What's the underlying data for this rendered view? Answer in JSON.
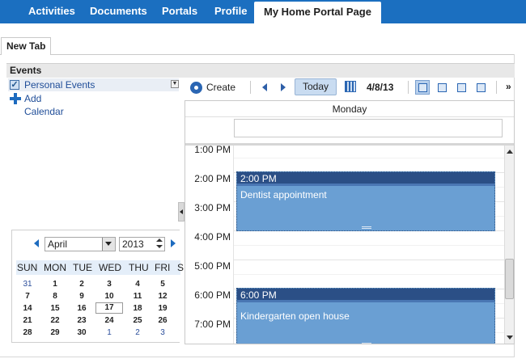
{
  "nav": {
    "tabs": [
      {
        "label": "Activities"
      },
      {
        "label": "Documents"
      },
      {
        "label": "Portals"
      },
      {
        "label": "Profile"
      },
      {
        "label": "My Home Portal Page",
        "active": true
      }
    ]
  },
  "page_tab": {
    "label": "New Tab"
  },
  "events_section": {
    "title": "Events",
    "calendars": [
      {
        "label": "Personal Events",
        "checked": true
      },
      {
        "label": "Add Calendar"
      }
    ]
  },
  "mini_calendar": {
    "month": "April",
    "year": "2013",
    "weekdays": [
      "SUN",
      "MON",
      "TUE",
      "WED",
      "THU",
      "FRI",
      "S"
    ],
    "weeks": [
      [
        "31",
        "1",
        "2",
        "3",
        "4",
        "5"
      ],
      [
        "7",
        "8",
        "9",
        "10",
        "11",
        "12"
      ],
      [
        "14",
        "15",
        "16",
        "17",
        "18",
        "19"
      ],
      [
        "21",
        "22",
        "23",
        "24",
        "25",
        "26"
      ],
      [
        "28",
        "29",
        "30",
        "1",
        "2",
        "3"
      ]
    ],
    "today": "17"
  },
  "toolbar": {
    "create_label": "Create",
    "today_label": "Today",
    "date": "4/8/13",
    "more_label": "»"
  },
  "day_view": {
    "day_name": "Monday",
    "hours": [
      "1:00 PM",
      "2:00 PM",
      "3:00 PM",
      "4:00 PM",
      "5:00 PM",
      "6:00 PM",
      "7:00 PM"
    ],
    "events": [
      {
        "time": "2:00 PM",
        "title": "Dentist appointment"
      },
      {
        "time": "6:00 PM",
        "title": "Kindergarten open house"
      }
    ]
  },
  "colors": {
    "nav_bar": "#1b6fc0",
    "event_fill": "#6a9fd3",
    "event_header": "#2b4f86",
    "link": "#1f4d98"
  }
}
